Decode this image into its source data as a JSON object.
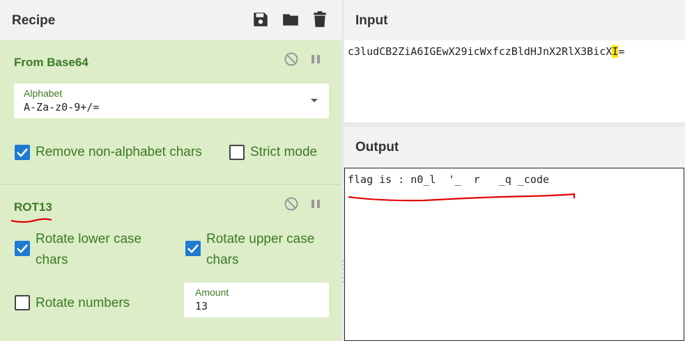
{
  "recipe": {
    "title": "Recipe",
    "icons": [
      "save-icon",
      "folder-icon",
      "trash-icon"
    ]
  },
  "operations": [
    {
      "name": "From Base64",
      "alphabet_label": "Alphabet",
      "alphabet_value": "A-Za-z0-9+/=",
      "checkboxes": [
        {
          "label": "Remove non-alphabet chars",
          "checked": true
        },
        {
          "label": "Strict mode",
          "checked": false
        }
      ]
    },
    {
      "name": "ROT13",
      "checkboxes": [
        {
          "label_line1": "Rotate lower case",
          "label_line2": "chars",
          "checked": true
        },
        {
          "label_line1": "Rotate upper case",
          "label_line2": "chars",
          "checked": true
        },
        {
          "label": "Rotate numbers",
          "checked": false
        }
      ],
      "amount_label": "Amount",
      "amount_value": "13"
    }
  ],
  "input": {
    "title": "Input",
    "text_before": "c3ludCB2ZiA6IGEwX29icWxfczBldHJnX2RlX3BicX",
    "cursor_char": "I",
    "text_after": "="
  },
  "output": {
    "title": "Output",
    "text": "flag is : n0_l  '_  r   _q _code"
  },
  "colors": {
    "op_background": "#dcedc8",
    "op_title": "#3b7a24",
    "checkbox_on": "#1e7bd3",
    "cursor_highlight": "#ffe600",
    "annotation_red": "#e00000"
  }
}
